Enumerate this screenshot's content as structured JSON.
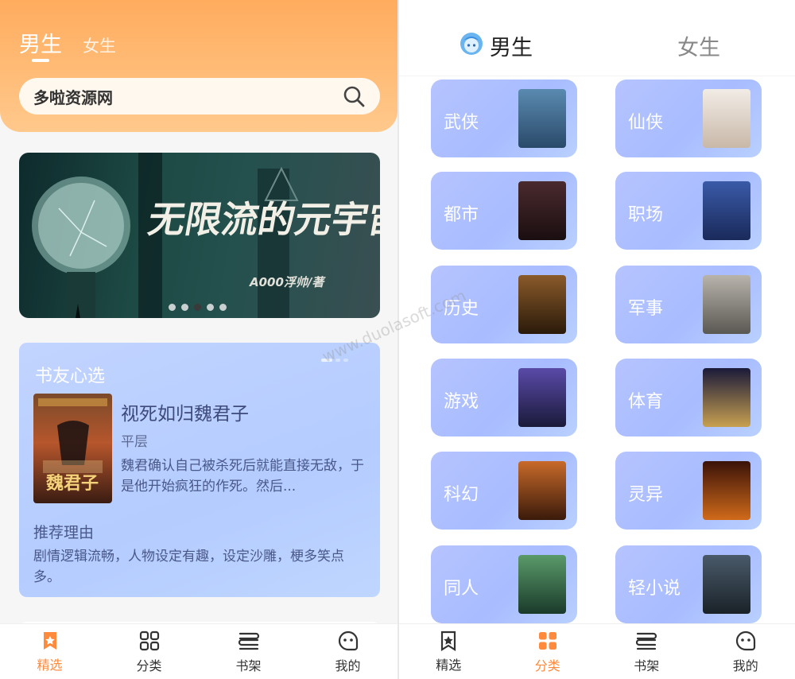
{
  "left": {
    "tabs": {
      "male": "男生",
      "female": "女生"
    },
    "search": {
      "placeholder": "多啦资源网"
    },
    "banner": {
      "title": "无限流的元宇宙",
      "author": "A000浮帅/著",
      "dots": 5,
      "active_dot": 2
    },
    "pick": {
      "section_title": "书友心选",
      "book_title": "视死如归魏君子",
      "author": "平层",
      "description": "魏君确认自己被杀死后就能直接无敌，于是他开始疯狂的作死。然后...",
      "reason_title": "推荐理由",
      "reason_text": "剧情逻辑流畅，人物设定有趣，设定沙雕，梗多笑点多。"
    },
    "nav": [
      {
        "label": "精选",
        "icon": "bookmark-star-icon",
        "active": true
      },
      {
        "label": "分类",
        "icon": "grid-icon",
        "active": false
      },
      {
        "label": "书架",
        "icon": "bookshelf-icon",
        "active": false
      },
      {
        "label": "我的",
        "icon": "face-icon",
        "active": false
      }
    ]
  },
  "right": {
    "tabs": {
      "male": "男生",
      "female": "女生"
    },
    "categories": [
      {
        "label": "武侠",
        "cover_color": "#3a6f9a"
      },
      {
        "label": "仙侠",
        "cover_color": "#e8dcd0"
      },
      {
        "label": "都市",
        "cover_color": "#3a2226"
      },
      {
        "label": "职场",
        "cover_color": "#2a4a8a"
      },
      {
        "label": "历史",
        "cover_color": "#5a3a1a"
      },
      {
        "label": "军事",
        "cover_color": "#8a8880"
      },
      {
        "label": "游戏",
        "cover_color": "#3a2a6a"
      },
      {
        "label": "体育",
        "cover_color": "#1a1a3a"
      },
      {
        "label": "科幻",
        "cover_color": "#8a3a1a"
      },
      {
        "label": "灵异",
        "cover_color": "#4a1a0a"
      },
      {
        "label": "同人",
        "cover_color": "#2a6a4a"
      },
      {
        "label": "轻小说",
        "cover_color": "#2a3a4a"
      }
    ],
    "nav": [
      {
        "label": "精选",
        "icon": "bookmark-star-icon",
        "active": false
      },
      {
        "label": "分类",
        "icon": "grid-icon",
        "active": true
      },
      {
        "label": "书架",
        "icon": "bookshelf-icon",
        "active": false
      },
      {
        "label": "我的",
        "icon": "face-icon",
        "active": false
      }
    ]
  },
  "watermark": "www.duolasoft.com"
}
